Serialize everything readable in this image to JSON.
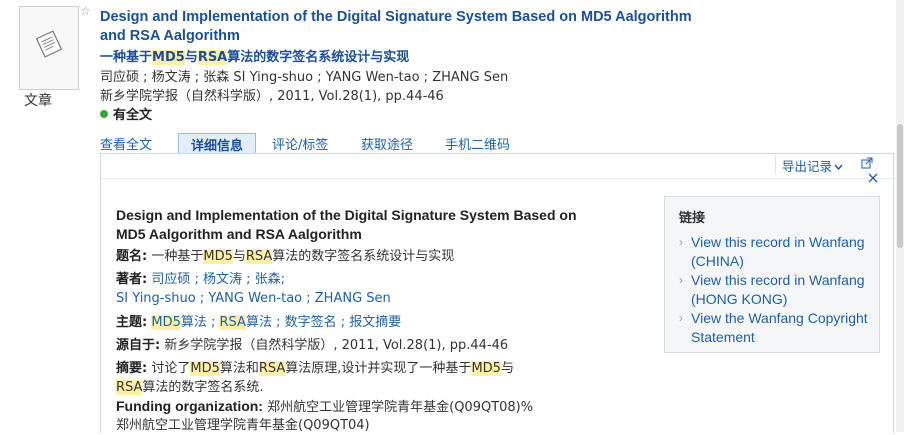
{
  "result": {
    "type_label": "文章",
    "title_en": "Design and Implementation of the Digital Signature System Based on MD5 Aalgorithm and RSA Aalgorithm",
    "title_cn_parts": [
      "一种基于",
      "MD5",
      "与",
      "RSA",
      "算法的数字签名系统设计与实现"
    ],
    "authors": "司应硕 ; 杨文涛 ; 张森 SI Ying-shuo ; YANG Wen-tao ; ZHANG Sen",
    "journal": "新乡学院学报（自然科学版）, 2011, Vol.28(1), pp.44-46",
    "fulltext": "有全文"
  },
  "tabs": [
    "查看全文",
    "详细信息",
    "评论/标签",
    "获取途径",
    "手机二维码"
  ],
  "toolbar": {
    "export_label": "导出记录",
    "export_icon": "chevron-down-icon",
    "icons": [
      "external-link-icon",
      "close-icon"
    ]
  },
  "detail": {
    "title_en": "Design and Implementation of the Digital Signature System Based on MD5 Aalgorithm and RSA Aalgorithm",
    "title_label": "题名:",
    "title_cn_parts": [
      "一种基于",
      "MD5",
      "与",
      "RSA",
      "算法的数字签名系统设计与实现"
    ],
    "author_label": "著者:",
    "authors_cn": "司应硕 ; 杨文涛 ; 张森;",
    "authors_en": "SI Ying-shuo ; YANG Wen-tao ; ZHANG Sen",
    "subject_label": "主题:",
    "subjects": [
      "MD5",
      "算法",
      " ; ",
      "RSA",
      "算法",
      " ; 数字签名 ; 报文摘要"
    ],
    "source_label": "源自于:",
    "source": "新乡学院学报（自然科学版）, 2011, Vol.28(1), pp.44-46",
    "abstract_label": "摘要:",
    "abstract_parts": [
      "讨论了",
      "MD5",
      "算法和",
      "RSA",
      "算法原理,设计并实现了一种基于",
      "MD5",
      "与"
    ],
    "abstract_line2_parts": [
      "RSA",
      "算法的数字签名系统."
    ],
    "funding_label": "Funding organization:",
    "funding_1": "郑州航空工业管理学院青年基金(Q09QT08)%",
    "funding_2": "郑州航空工业管理学院青年基金(Q09QT04)"
  },
  "links": {
    "title": "链接",
    "items": [
      "View this record in Wanfang (CHINA)",
      "View this record in Wanfang (HONG KONG)",
      "View the Wanfang Copyright Statement"
    ]
  },
  "colors": {
    "title": "#1c4f98",
    "link": "#1f5fa6",
    "highlight": "#fff0a8",
    "fulltext_dot": "#3aa53a"
  }
}
